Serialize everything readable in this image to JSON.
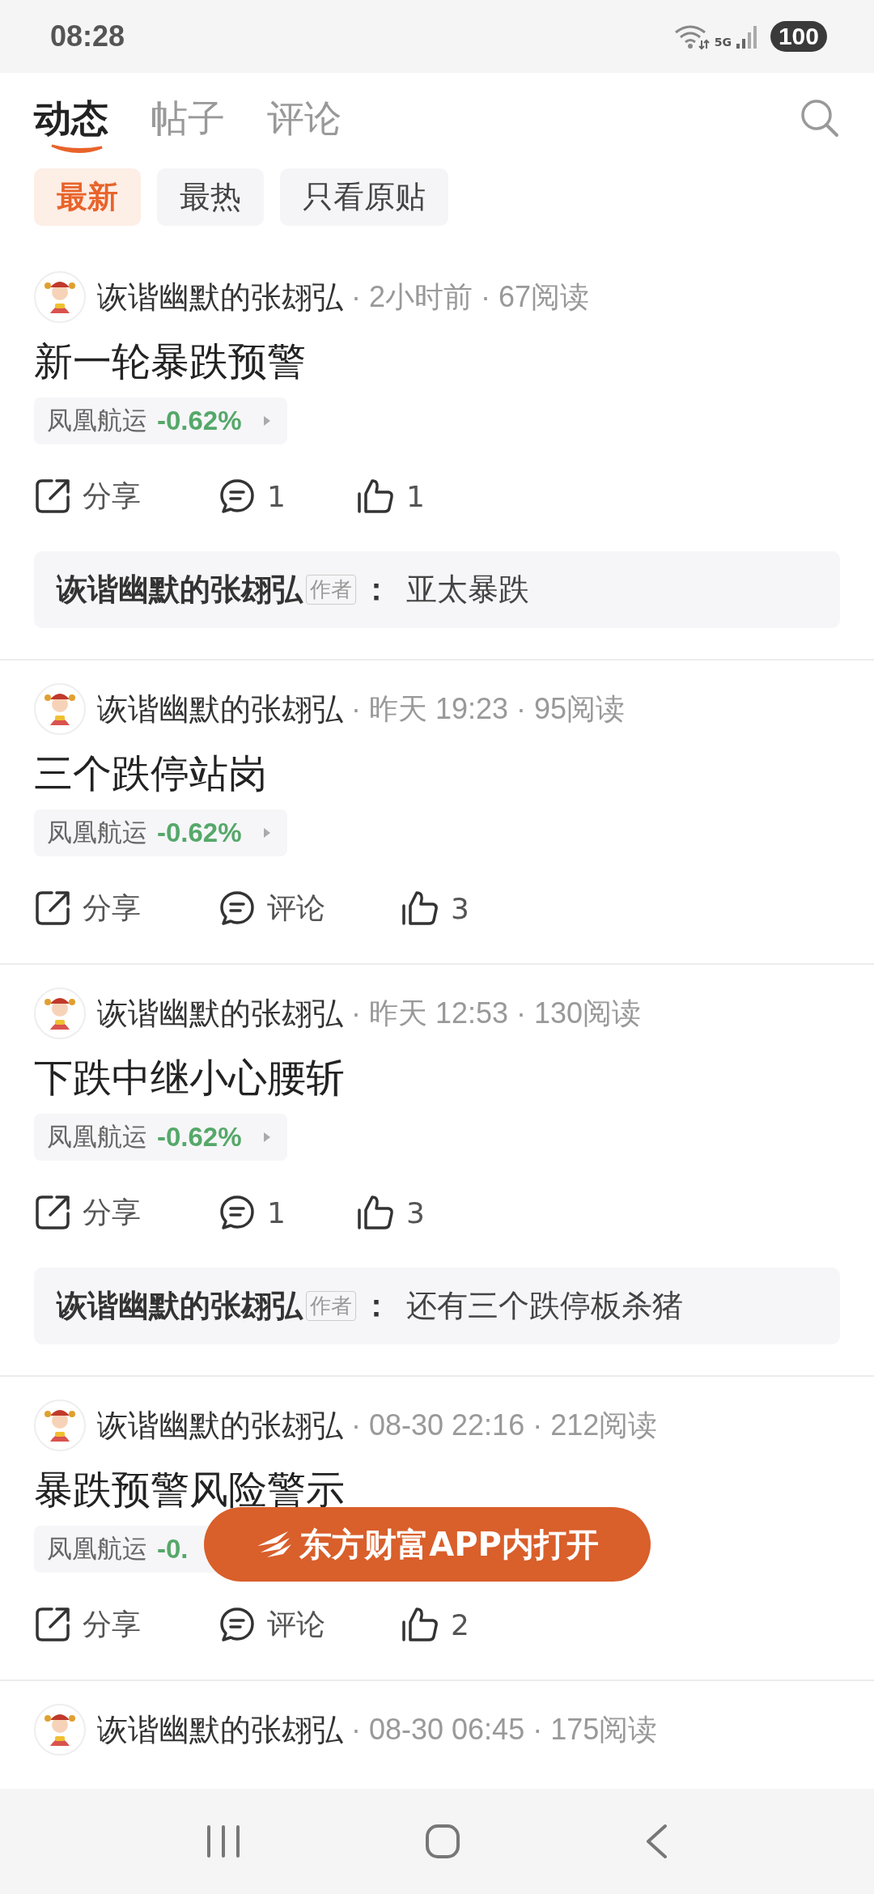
{
  "status_bar": {
    "time": "08:28",
    "network": "5G",
    "battery": "100"
  },
  "tabs": [
    {
      "label": "动态",
      "selected": true
    },
    {
      "label": "帖子",
      "selected": false
    },
    {
      "label": "评论",
      "selected": false
    }
  ],
  "filters": [
    {
      "label": "最新",
      "selected": true
    },
    {
      "label": "最热",
      "selected": false
    },
    {
      "label": "只看原贴",
      "selected": false
    }
  ],
  "posts": [
    {
      "author": "诙谐幽默的张翃弘",
      "meta": "· 2小时前 · 67阅读",
      "title": "新一轮暴跌预警",
      "stock": {
        "name": "凤凰航运",
        "change": "-0.62%",
        "caret": true
      },
      "share": "分享",
      "comments": "1",
      "likes": "1",
      "reply": {
        "author": "诙谐幽默的张翃弘",
        "badge": "作者",
        "colon": "：",
        "text": "亚太暴跌"
      }
    },
    {
      "author": "诙谐幽默的张翃弘",
      "meta": "· 昨天 19:23 · 95阅读",
      "title": "三个跌停站岗",
      "stock": {
        "name": "凤凰航运",
        "change": "-0.62%",
        "caret": true
      },
      "share": "分享",
      "comments": "评论",
      "likes": "3"
    },
    {
      "author": "诙谐幽默的张翃弘",
      "meta": "· 昨天 12:53 · 130阅读",
      "title": "下跌中继小心腰斩",
      "stock": {
        "name": "凤凰航运",
        "change": "-0.62%",
        "caret": true
      },
      "share": "分享",
      "comments": "1",
      "likes": "3",
      "reply": {
        "author": "诙谐幽默的张翃弘",
        "badge": "作者",
        "colon": "：",
        "text": "还有三个跌停板杀猪"
      }
    },
    {
      "author": "诙谐幽默的张翃弘",
      "meta": "· 08-30 22:16 · 212阅读",
      "title": "暴跌预警风险警示",
      "stock": {
        "name": "凤凰航运",
        "change": "-0."
      },
      "share": "分享",
      "comments": "评论",
      "likes": "2"
    },
    {
      "author": "诙谐幽默的张翃弘",
      "meta": "· 08-30 06:45 · 175阅读"
    }
  ],
  "open_app_button": "东方财富APP内打开"
}
